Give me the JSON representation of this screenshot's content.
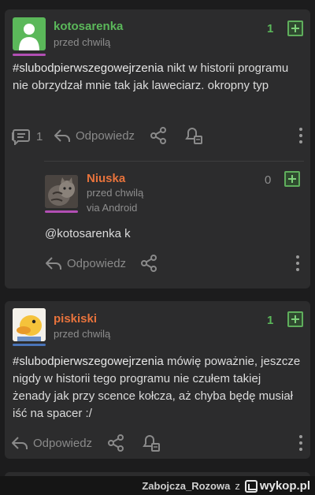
{
  "comments": [
    {
      "author": "kotosarenka",
      "author_color": "#5bb85a",
      "time": "przed chwilą",
      "votes": "1",
      "hashtag": "#slubodpierwszegowejrzenia",
      "text_rest": " nikt w historii programu nie obrzydzał mnie tak jak laweciarz. okropny typ",
      "reply_count": "1",
      "reply_label": "Odpowiedz",
      "avatar_icon": "default-user-avatar"
    },
    {
      "author": "Niuska",
      "author_color": "#e8733c",
      "time": "przed chwilą",
      "via": "via Android",
      "votes": "0",
      "text": "@kotosarenka k",
      "reply_label": "Odpowiedz",
      "avatar_icon": "cat-photo-avatar"
    },
    {
      "author": "piskiski",
      "author_color": "#e8733c",
      "time": "przed chwilą",
      "votes": "1",
      "hashtag": "#slubodpierwszegowejrzenia",
      "text_rest": " mówię poważnie, jeszcze nigdy w historii tego programu nie czułem takiej żenady jak przy scence kołcza, aż chyba będę musiał iść na spacer :/",
      "reply_label": "Odpowiedz",
      "avatar_icon": "duck-avatar"
    }
  ],
  "watermark": {
    "user": "Zabojcza_Rozowa",
    "connector": "z",
    "site": "wykop.pl"
  },
  "colors": {
    "vote_green": "#5bb85a",
    "underline_purple": "#b24fb4",
    "underline_blue": "#4a74b8"
  }
}
